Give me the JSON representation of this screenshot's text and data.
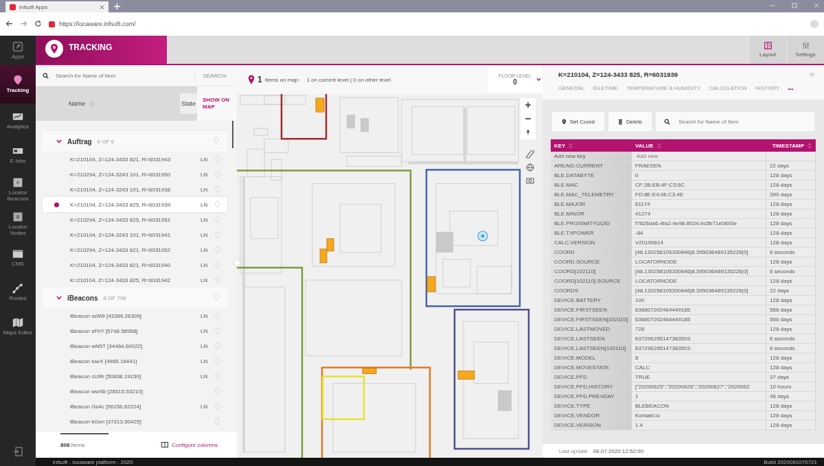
{
  "browser": {
    "tab_title": "infsoft Apps",
    "url": "https://locaware.infsoft.com/"
  },
  "nav": {
    "items": [
      {
        "label": "Apps",
        "selected": false
      },
      {
        "label": "Tracking",
        "selected": true
      },
      {
        "label": "Analytics",
        "selected": false
      },
      {
        "label": "E-Inks",
        "selected": false
      },
      {
        "label": "Locator Beacons",
        "selected": false
      },
      {
        "label": "Locator Nodes",
        "selected": false
      },
      {
        "label": "CMS",
        "selected": false
      },
      {
        "label": "Routes",
        "selected": false
      },
      {
        "label": "Maps Editor",
        "selected": false
      }
    ]
  },
  "header": {
    "title": "TRACKING",
    "buttons": [
      "Layout",
      "Settings"
    ]
  },
  "item_list": {
    "search_placeholder": "Search for Name of Item",
    "search_button": "SEARCH",
    "columns": {
      "name": "Name",
      "state": "State",
      "show_on_map": "SHOW ON MAP"
    },
    "groups": [
      {
        "name": "Auftrag",
        "count": "9 OF 9",
        "expanded": true,
        "items": [
          {
            "name": "K=210104, Z=124-3433 821, R=6031943",
            "state": "LN",
            "selected": false
          },
          {
            "name": "K=210294, Z=124-3243 101, R=6031950",
            "state": "LN",
            "selected": false
          },
          {
            "name": "K=210104, Z=124-3243 101, R=6031938",
            "state": "LN",
            "selected": false
          },
          {
            "name": "K=210104, Z=124-3433 825, R=6031939",
            "state": "LN",
            "selected": true
          },
          {
            "name": "K=210294, Z=124-3433 825, R=6031951",
            "state": "LN",
            "selected": false
          },
          {
            "name": "K=210104, Z=124-3243 101, R=6031941",
            "state": "LN",
            "selected": false
          },
          {
            "name": "K=210294, Z=124-3433 821, R=6031952",
            "state": "LN",
            "selected": false
          },
          {
            "name": "K=210104, Z=124-3433 821, R=6031940",
            "state": "LN",
            "selected": false
          },
          {
            "name": "K=210104, Z=124-3433 825, R=6031942",
            "state": "LN",
            "selected": false
          }
        ]
      },
      {
        "name": "iBeacons",
        "count": "8 OF 799",
        "expanded": true,
        "items": [
          {
            "name": "iBeacon ocM9 [43386.26309]",
            "state": "LN",
            "selected": false
          },
          {
            "name": "iBeacon sFhY [5748.58968]",
            "state": "LN",
            "selected": false
          },
          {
            "name": "iBeacon wN5T [34464.60022]",
            "state": "LN",
            "selected": false
          },
          {
            "name": "iBeacon luwX [4985.16441]",
            "state": "LN",
            "selected": false
          },
          {
            "name": "iBeacon cU9h [50838.19150]",
            "state": "LN",
            "selected": false
          },
          {
            "name": "iBeacon wwSb [28515.53210]",
            "selected": false
          },
          {
            "name": "iBeacon Gs4c [56156.62224]",
            "state": "LN",
            "selected": false
          },
          {
            "name": "iBeacon kGon [37313.50425]",
            "selected": false
          }
        ]
      }
    ],
    "total": "808",
    "total_label": "Items",
    "configure": "Configure columns"
  },
  "map": {
    "count": "1",
    "summary_label": "Items on map:",
    "summary": "1 on current level | 0 on other level",
    "floor_label": "FLOOR LEVEL",
    "floor": "0"
  },
  "details": {
    "title": "K=210104, Z=124-3433 825, R=6031939",
    "tabs": [
      {
        "label": "GENERAL",
        "selected": false
      },
      {
        "label": "IDLETIME",
        "selected": false
      },
      {
        "label": "TEMPERATURE & HUMIDITY",
        "selected": false
      },
      {
        "label": "CALCULATION",
        "selected": false
      },
      {
        "label": "HISTORY",
        "selected": false
      }
    ],
    "more": "•••",
    "actions": [
      "Set Coord",
      "Delete"
    ],
    "search_placeholder": "Search for Name of Item",
    "table": {
      "columns": [
        "KEY",
        "VALUE",
        "TIMESTAMP"
      ],
      "new_key": "Add new key",
      "new_value_placeholder": "Add new",
      "rows": [
        [
          "AREAID.CURRENT",
          "FRAESEN",
          "22 days"
        ],
        [
          "BLE.DATABYTE",
          "0",
          "128 days"
        ],
        [
          "BLE.MAC",
          "CF:2B:EB:4F:C3:5C",
          "128 days"
        ],
        [
          "BLE.MAC_TELEMETRY",
          "FD:8E:E4:06:C3:4E",
          "390 days"
        ],
        [
          "BLE.MAJOR",
          "61174",
          "128 days"
        ],
        [
          "BLE.MINOR",
          "41274",
          "128 days"
        ],
        [
          "BLE.PROXIMITYUUID",
          "f7826da6-4fa2-4e98-8024-bc5b71e0893e",
          "128 days"
        ],
        [
          "BLE.TXPOWER",
          "-84",
          "128 days"
        ],
        [
          "CALC.VERSION",
          "V20190614",
          "128 days"
        ],
        [
          "COORD",
          "[48.130258105330846|8.395036489135226|0]",
          "6 seconds"
        ],
        [
          "COORD.SOURCE",
          "LOCATORNODE",
          "128 days"
        ],
        [
          "COORD[102110]",
          "[48.130258105330846|8.395036489135226|0]",
          "6 seconds"
        ],
        [
          "COORD[102110].SOURCE",
          "LOCATORNODE",
          "128 days"
        ],
        [
          "COORDS",
          "[48.130258105330846|8.395036489135226|0]",
          "22 days"
        ],
        [
          "DEVICE.BATTERY",
          "100",
          "128 days"
        ],
        [
          "DEVICE.FIRSTSEEN",
          "636807202464449185",
          "566 days"
        ],
        [
          "DEVICE.FIRSTSEEN[102110]",
          "636807202464449185",
          "566 days"
        ],
        [
          "DEVICE.LASTMOVED",
          "728",
          "128 days"
        ],
        [
          "DEVICE.LASTSEEN",
          "637296295147383503",
          "6 seconds"
        ],
        [
          "DEVICE.LASTSEEN[102110]",
          "637296295147383503",
          "6 seconds"
        ],
        [
          "DEVICE.MODEL",
          "8",
          "128 days"
        ],
        [
          "DEVICE.MOVESTATE",
          "CALC",
          "128 days"
        ],
        [
          "DEVICE.PFD",
          "TRUE",
          "37 days"
        ],
        [
          "DEVICE.PFD.HISTORY",
          "[\"20200625\",\"20200626\",\"20200627\",\"2020062",
          "10 hours"
        ],
        [
          "DEVICE.PFD.PREVDAY",
          "1",
          "46 days"
        ],
        [
          "DEVICE.TYPE",
          "BLEBEACON",
          "128 days"
        ],
        [
          "DEVICE.VENDOR",
          "Kontakt.io",
          "128 days"
        ],
        [
          "DEVICE.VERSION",
          "1.4",
          "128 days"
        ]
      ]
    },
    "last_update_label": "Last update",
    "last_update": "06.07.2020 12:52:00"
  },
  "footer": {
    "left": "infsoft - locaware platform - 2020",
    "right": "Build 2020061070721"
  }
}
